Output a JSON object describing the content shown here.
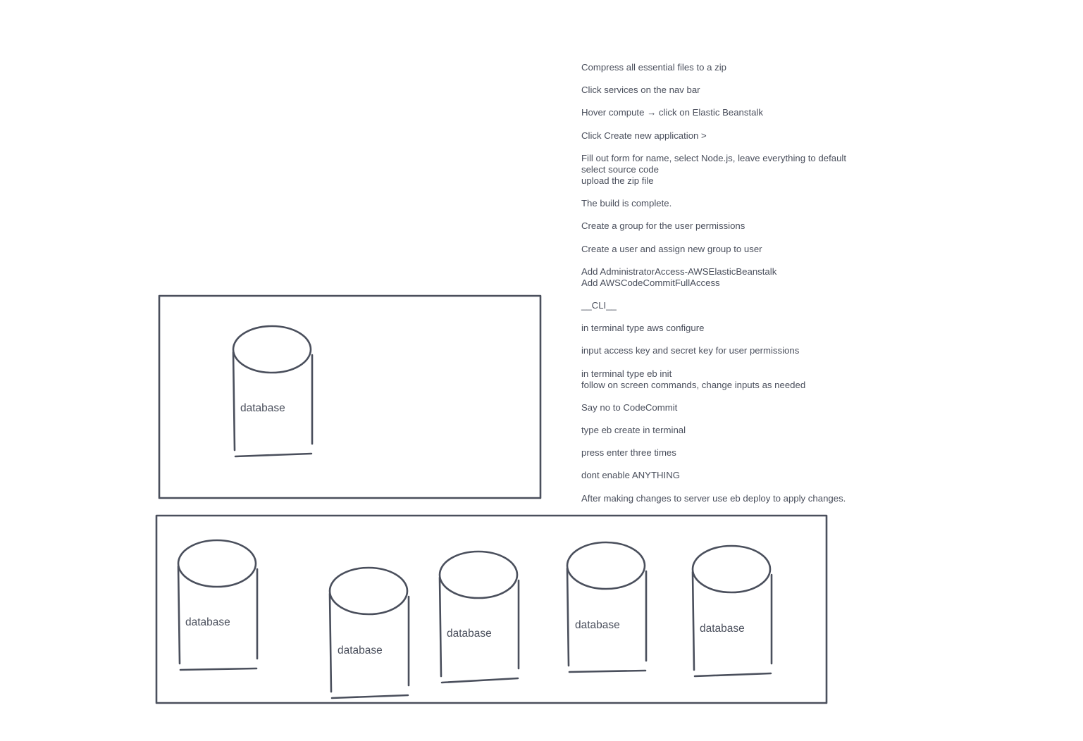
{
  "diagram": {
    "stroke_color": "#4a4f5c",
    "background": "#ffffff",
    "single_group": {
      "databases": [
        {
          "label": "database"
        }
      ]
    },
    "cluster_group": {
      "databases": [
        {
          "label": "database"
        },
        {
          "label": "database"
        },
        {
          "label": "database"
        },
        {
          "label": "database"
        },
        {
          "label": "database"
        }
      ]
    }
  },
  "notes": [
    {
      "lines": [
        "Compress all essential files to a zip"
      ]
    },
    {
      "lines": [
        "Click services on the nav bar"
      ]
    },
    {
      "lines": [
        "Hover compute → click on Elastic Beanstalk"
      ]
    },
    {
      "lines": [
        "Click Create new application >"
      ]
    },
    {
      "lines": [
        "Fill out form for name, select Node.js, leave everything to default",
        "select source code",
        "upload the zip file"
      ]
    },
    {
      "lines": [
        "The build is complete."
      ]
    },
    {
      "lines": [
        "Create a group for the user permissions"
      ]
    },
    {
      "lines": [
        "Create a user and assign new group to user"
      ]
    },
    {
      "lines": [
        "Add AdministratorAccess-AWSElasticBeanstalk",
        "Add AWSCodeCommitFullAccess"
      ]
    },
    {
      "lines": [
        "__CLI__"
      ]
    },
    {
      "lines": [
        "in terminal type aws configure"
      ]
    },
    {
      "lines": [
        "input access key and secret key for user permissions"
      ]
    },
    {
      "lines": [
        "in terminal type eb init",
        "follow on screen commands, change inputs as needed"
      ]
    },
    {
      "lines": [
        "Say no to CodeCommit"
      ]
    },
    {
      "lines": [
        "type eb create in terminal"
      ]
    },
    {
      "lines": [
        "press enter three times"
      ]
    },
    {
      "lines": [
        "dont enable ANYTHING"
      ]
    },
    {
      "lines": [
        "After making changes to server use eb deploy to apply changes."
      ]
    }
  ]
}
